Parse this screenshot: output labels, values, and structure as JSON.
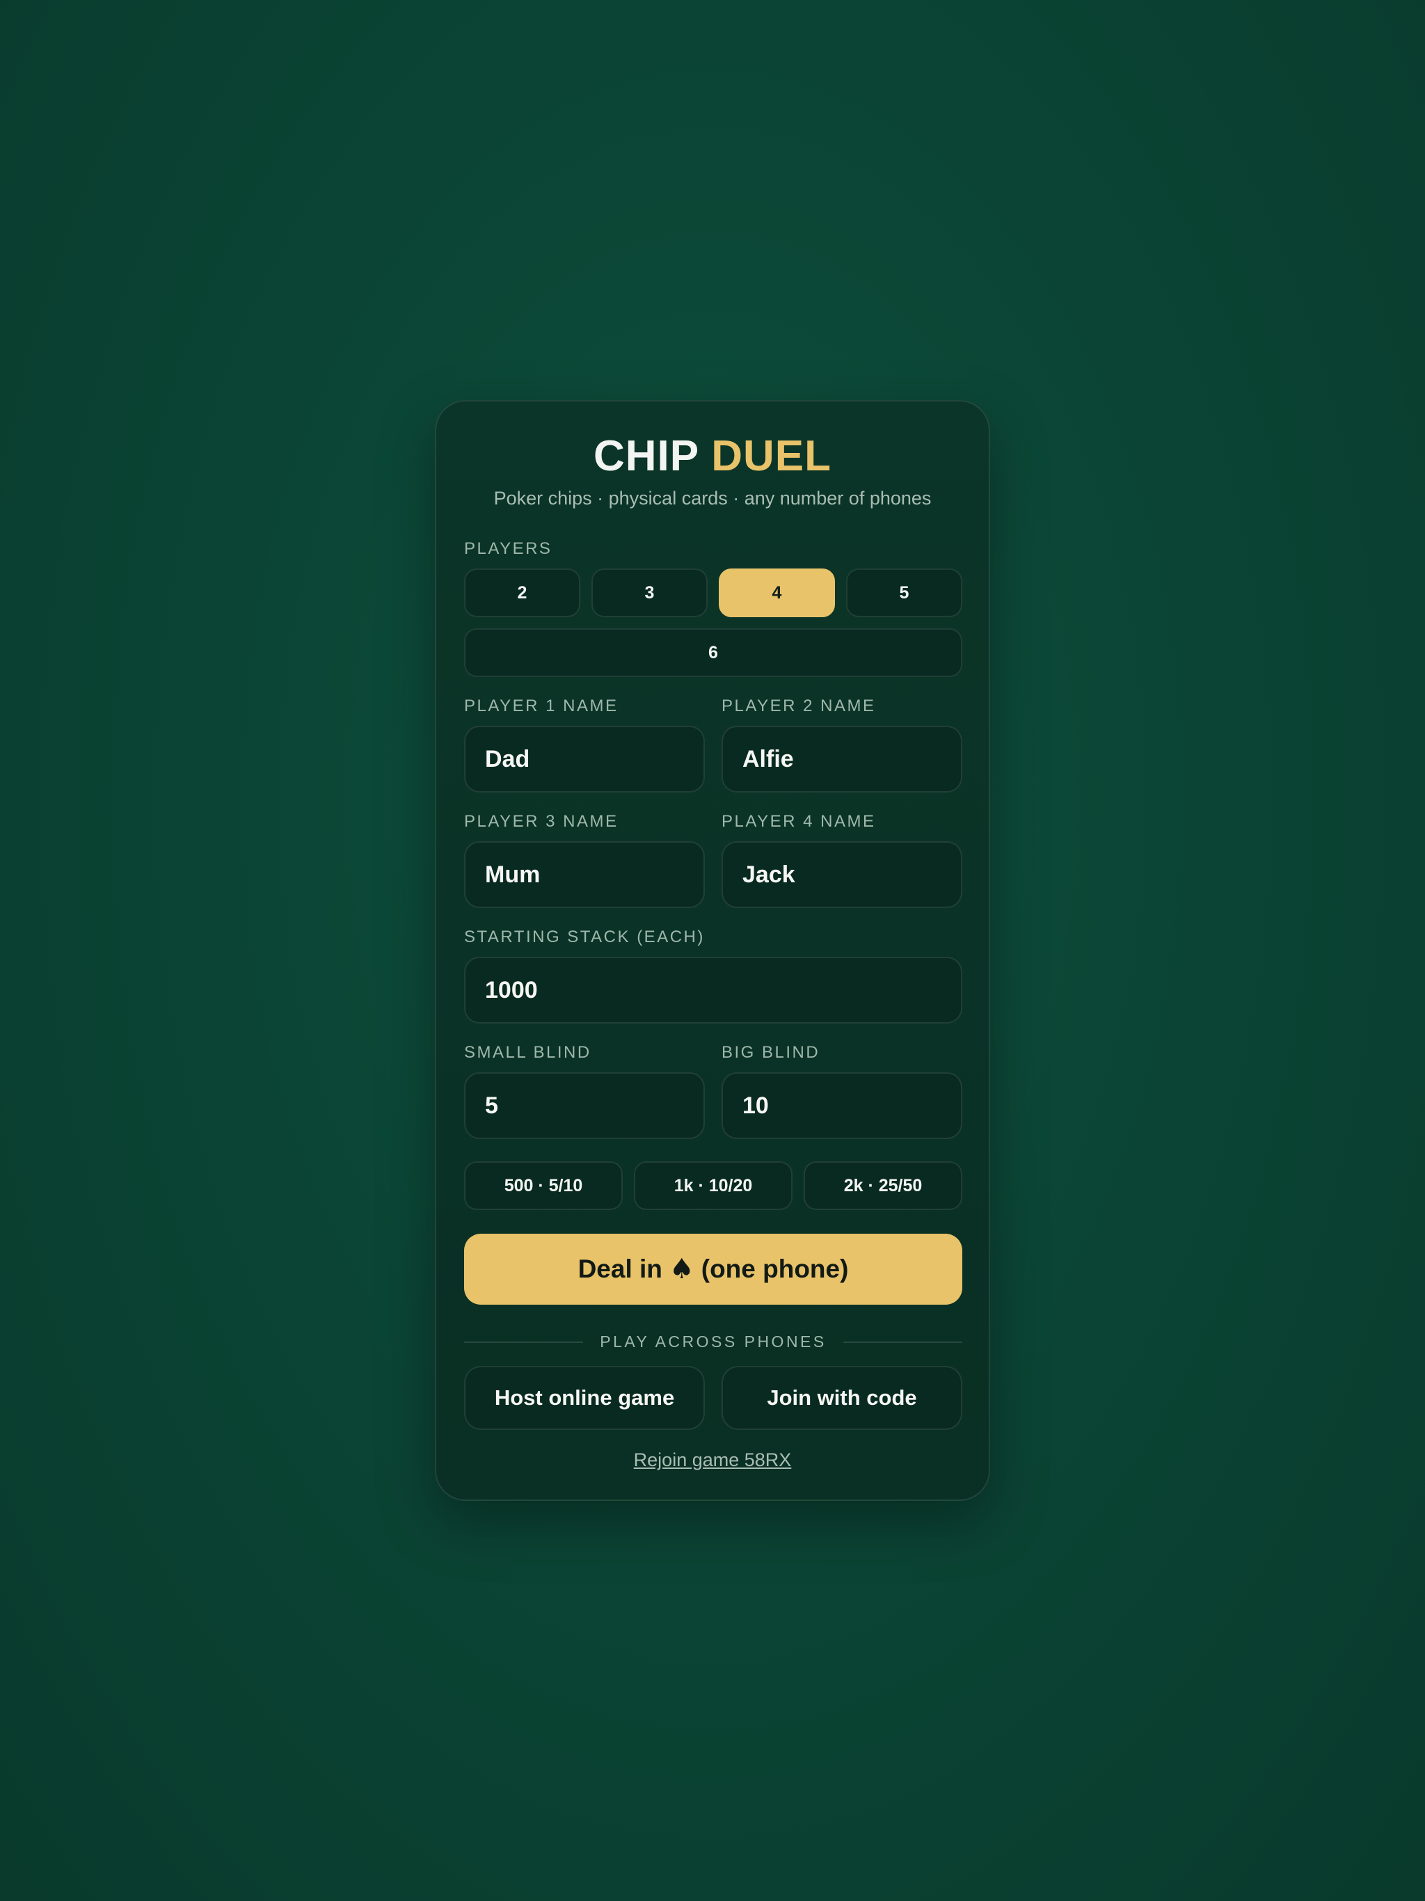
{
  "header": {
    "title_part1": "CHIP",
    "title_part2": "DUEL",
    "subtitle": "Poker chips · physical cards · any number of phones"
  },
  "players": {
    "label": "PLAYERS",
    "options": [
      "2",
      "3",
      "4",
      "5",
      "6"
    ],
    "selected": "4"
  },
  "names": [
    {
      "label": "PLAYER 1 NAME",
      "value": "Dad"
    },
    {
      "label": "PLAYER 2 NAME",
      "value": "Alfie"
    },
    {
      "label": "PLAYER 3 NAME",
      "value": "Mum"
    },
    {
      "label": "PLAYER 4 NAME",
      "value": "Jack"
    }
  ],
  "stack": {
    "label": "STARTING STACK (EACH)",
    "value": "1000"
  },
  "blinds": {
    "small_label": "SMALL BLIND",
    "small_value": "5",
    "big_label": "BIG BLIND",
    "big_value": "10"
  },
  "presets": [
    "500 · 5/10",
    "1k · 10/20",
    "2k · 25/50"
  ],
  "deal": {
    "label_before": "Deal in",
    "icon": "spade-icon",
    "glyph": "♠",
    "label_after": "(one phone)"
  },
  "online": {
    "divider": "PLAY ACROSS PHONES",
    "host_label": "Host online game",
    "join_label": "Join with code",
    "rejoin_label": "Rejoin game 58RX"
  },
  "colors": {
    "accent": "#e8c36a",
    "background": "#0b4535",
    "card": "#0a2f24",
    "field": "#082a20"
  }
}
